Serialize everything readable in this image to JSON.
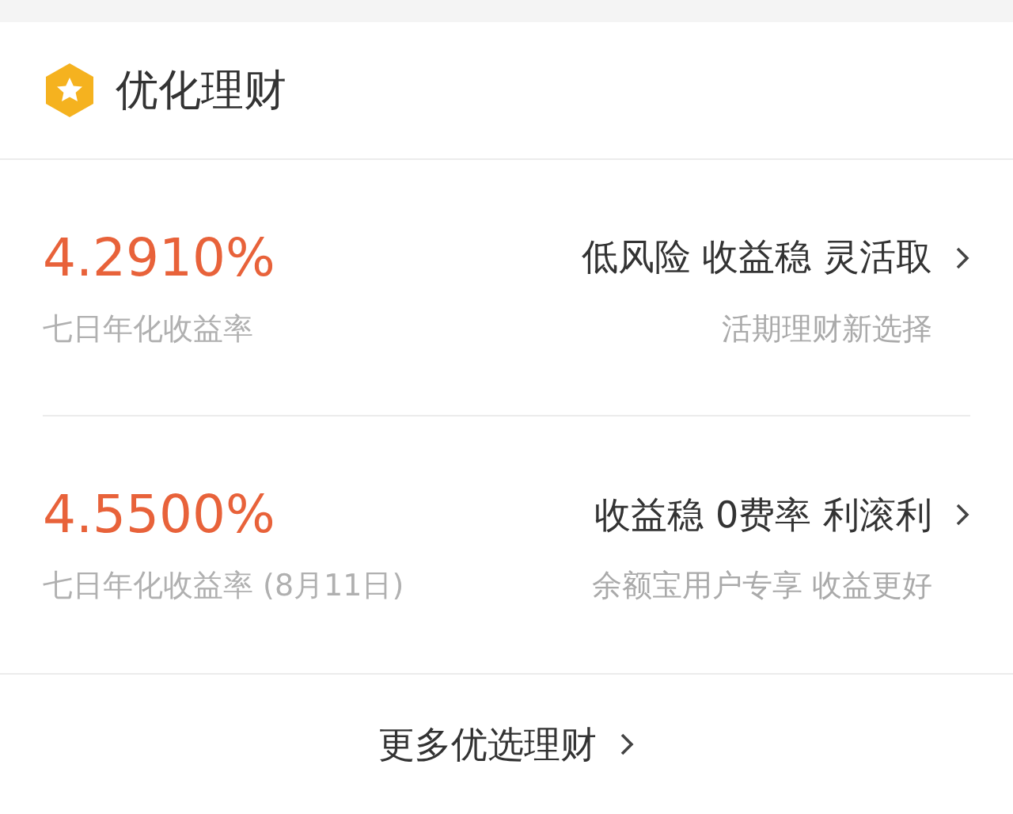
{
  "header": {
    "title": "优化理财"
  },
  "products": [
    {
      "rate": "4.2910%",
      "rate_label": "七日年化收益率",
      "tagline": "低风险 收益稳 灵活取",
      "subtitle": "活期理财新选择"
    },
    {
      "rate": "4.5500%",
      "rate_label": "七日年化收益率 (8月11日)",
      "tagline": "收益稳 0费率 利滚利",
      "subtitle": "余额宝用户专享 收益更好"
    }
  ],
  "more_link": "更多优选理财"
}
